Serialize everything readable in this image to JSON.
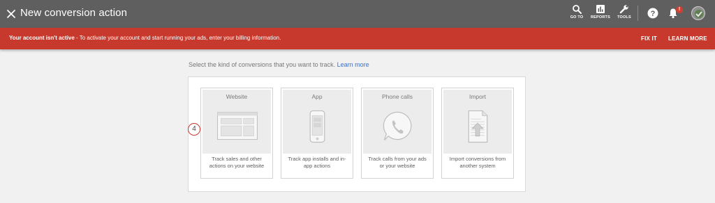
{
  "header": {
    "title": "New conversion action",
    "tools": [
      {
        "label": "GO TO",
        "icon": "search-icon"
      },
      {
        "label": "REPORTS",
        "icon": "reports-icon"
      },
      {
        "label": "TOOLS",
        "icon": "wrench-icon"
      }
    ],
    "notification_badge": "!"
  },
  "alert": {
    "strong": "Your account isn't active",
    "text": " - To activate your account and start running your ads, enter your billing information.",
    "fix_label": "FIX IT",
    "learn_label": "LEARN MORE"
  },
  "main": {
    "prompt": "Select the kind of conversions that you want to track.",
    "learn_more": "Learn more",
    "step_marker": "4",
    "tiles": [
      {
        "name": "Website",
        "desc": "Track sales and other actions on your website",
        "icon": "website-icon"
      },
      {
        "name": "App",
        "desc": "Track app installs and in-app actions",
        "icon": "phone-device-icon"
      },
      {
        "name": "Phone calls",
        "desc": "Track calls from your ads or your website",
        "icon": "phone-call-icon"
      },
      {
        "name": "Import",
        "desc": "Import conversions from another system",
        "icon": "import-file-icon"
      }
    ]
  },
  "colors": {
    "topbar": "#5f5f5f",
    "alert": "#c7392d",
    "link": "#3b6fc9"
  }
}
